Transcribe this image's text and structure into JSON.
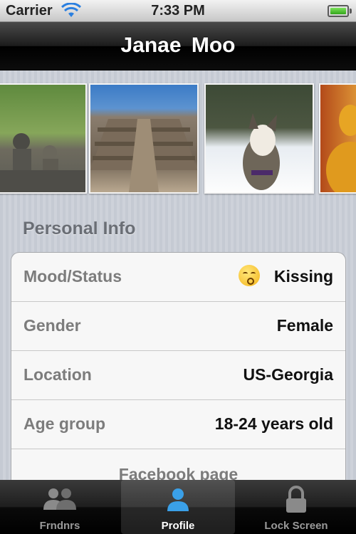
{
  "status_bar": {
    "carrier": "Carrier",
    "time": "7:33 PM"
  },
  "nav": {
    "title": "Janae Moo"
  },
  "photos": [
    {
      "icon": "temple-statues-photo"
    },
    {
      "icon": "borobudur-photo"
    },
    {
      "icon": "husky-dog-photo"
    },
    {
      "icon": "buddha-statue-photo"
    }
  ],
  "section": {
    "title": "Personal Info"
  },
  "rows": [
    {
      "label": "Mood/Status",
      "value": "Kissing",
      "icon": "kissing-face-icon"
    },
    {
      "label": "Gender",
      "value": "Female"
    },
    {
      "label": "Location",
      "value": "US-Georgia"
    },
    {
      "label": "Age group",
      "value": "18-24 years old"
    }
  ],
  "facebook": {
    "label": "Facebook page"
  },
  "tabs": [
    {
      "label": "Frndnrs",
      "icon": "friends-icon"
    },
    {
      "label": "Profile",
      "icon": "profile-icon",
      "selected": true
    },
    {
      "label": "Lock Screen",
      "icon": "lock-icon"
    }
  ],
  "colors": {
    "accent": "#3aa0e8",
    "battery": "#34a51b"
  }
}
